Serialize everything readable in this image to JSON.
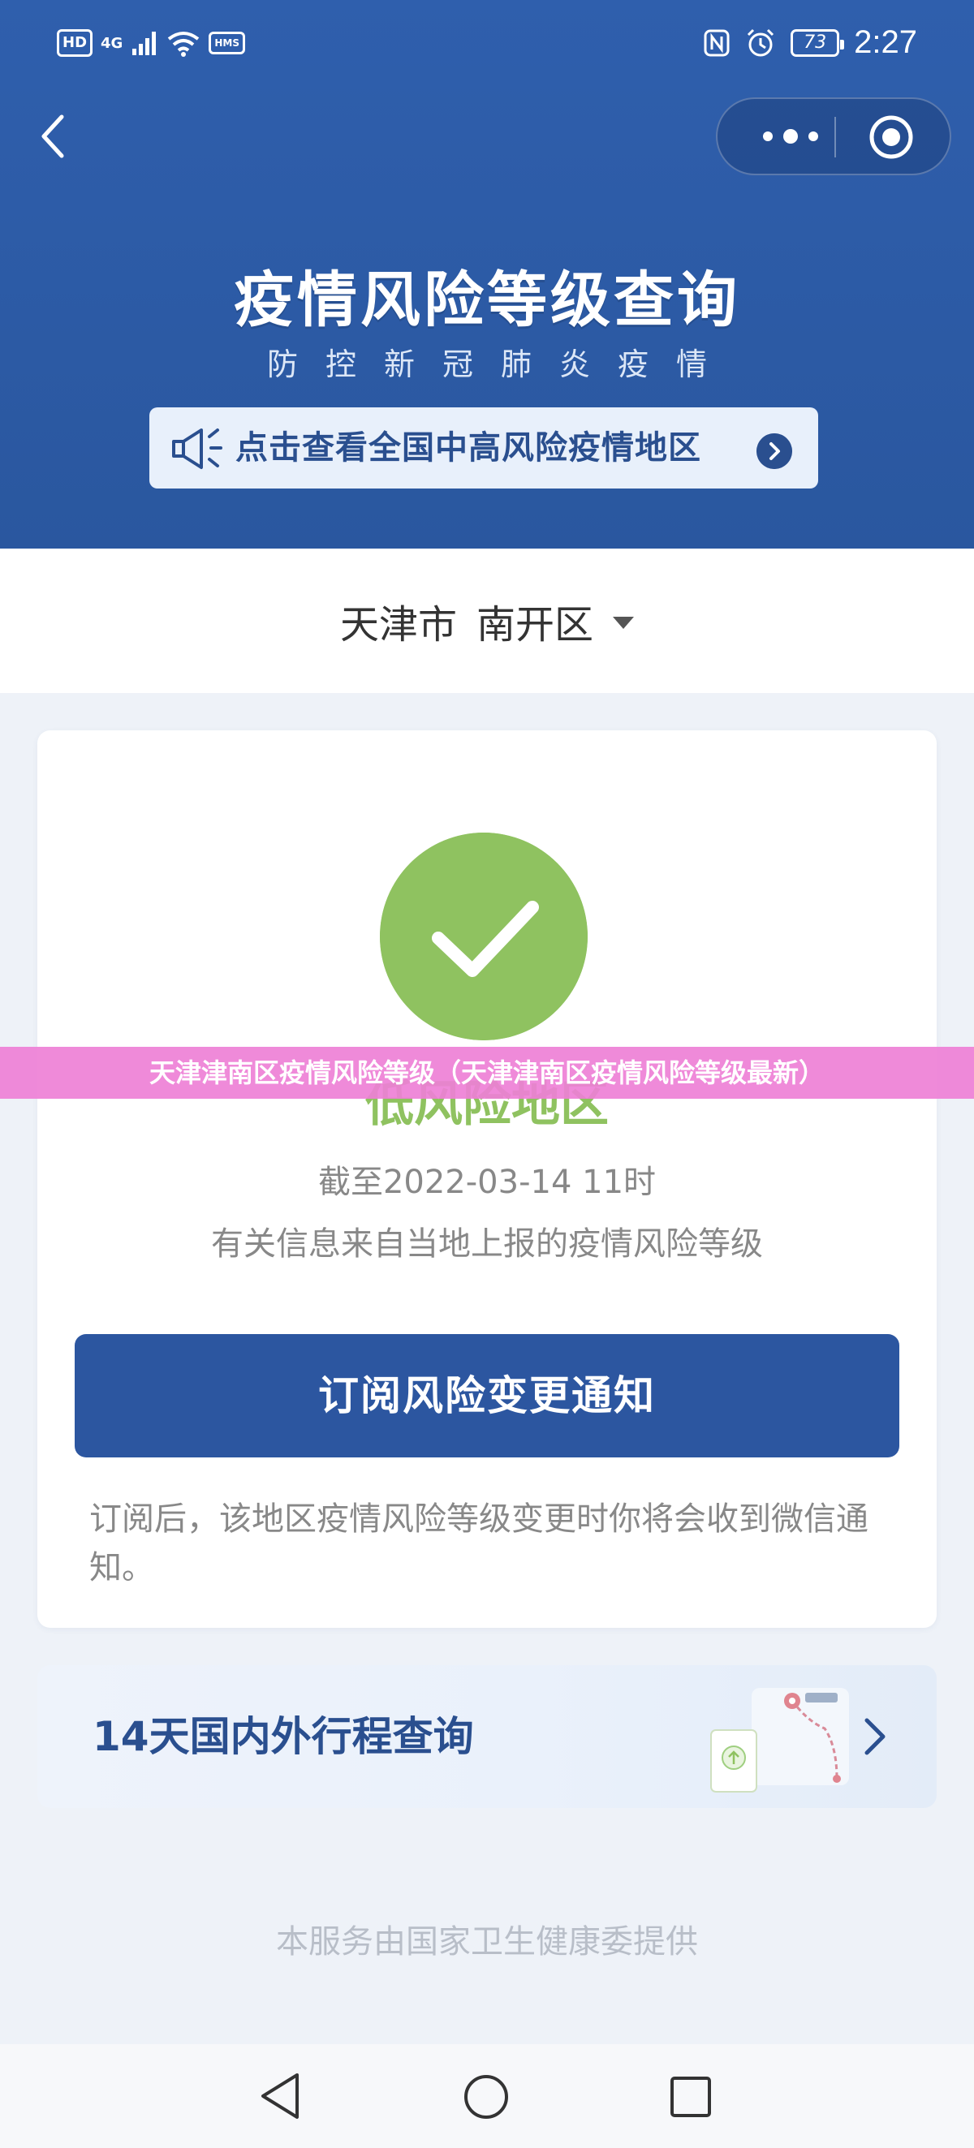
{
  "status_bar": {
    "hd_badge": "HD",
    "network": "4G",
    "sms_badge": "HMS",
    "battery_level": "73",
    "time": "2:27",
    "icons": [
      "signal-icon",
      "wifi-icon",
      "nfc-icon",
      "alarm-icon",
      "battery-icon"
    ]
  },
  "nav": {
    "back_icon": "chevron-left-icon",
    "more_icon": "more-dots-icon",
    "close_icon": "target-icon"
  },
  "header": {
    "title": "疫情风险等级查询",
    "subtitle": "防控新冠肺炎疫情",
    "notice_label": "点击查看全国中高风险疫情地区"
  },
  "location": {
    "city": "天津市",
    "district": "南开区"
  },
  "result": {
    "risk_level": "低风险地区",
    "as_of": "截至2022-03-14 11时",
    "source_note": "有关信息来自当地上报的疫情风险等级",
    "subscribe_button": "订阅风险变更通知",
    "subscribe_note": "订阅后，该地区疫情风险等级变更时你将会收到微信通知。",
    "status_color": "#8fc260"
  },
  "itinerary": {
    "label": "14天国内外行程查询"
  },
  "footer": {
    "provider_note": "本服务由国家卫生健康委提供"
  },
  "overlay": {
    "banner_text": "天津津南区疫情风险等级（天津津南区疫情风险等级最新）"
  },
  "colors": {
    "header_blue": "#2c5aa6",
    "button_blue": "#2c56a0",
    "low_risk_green": "#8fc260",
    "overlay_pink": "#ee80d6"
  }
}
